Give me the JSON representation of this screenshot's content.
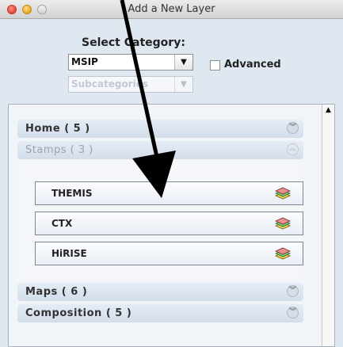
{
  "window": {
    "title": "Add a New Layer"
  },
  "category": {
    "heading": "Select Category:",
    "selected": "MSIP",
    "subcategory_placeholder": "Subcategories",
    "advanced_label": "Advanced",
    "advanced_checked": false
  },
  "sections": [
    {
      "label": "Home  ( 5 )",
      "state": "collapsed"
    },
    {
      "label": "Stamps  ( 3 )",
      "state": "expanded"
    },
    {
      "label": "Maps  ( 6 )",
      "state": "collapsed"
    },
    {
      "label": "Composition  ( 5 )",
      "state": "collapsed"
    }
  ],
  "stamps": [
    {
      "name": "THEMIS",
      "icon": "layers-icon"
    },
    {
      "name": "CTX",
      "icon": "layers-icon"
    },
    {
      "name": "HiRISE",
      "icon": "layers-icon"
    }
  ],
  "icons": {
    "collapsed": "double-chevron-down-icon",
    "expanded": "double-chevron-up-icon",
    "scroll": "scroll-up-arrow-icon"
  }
}
